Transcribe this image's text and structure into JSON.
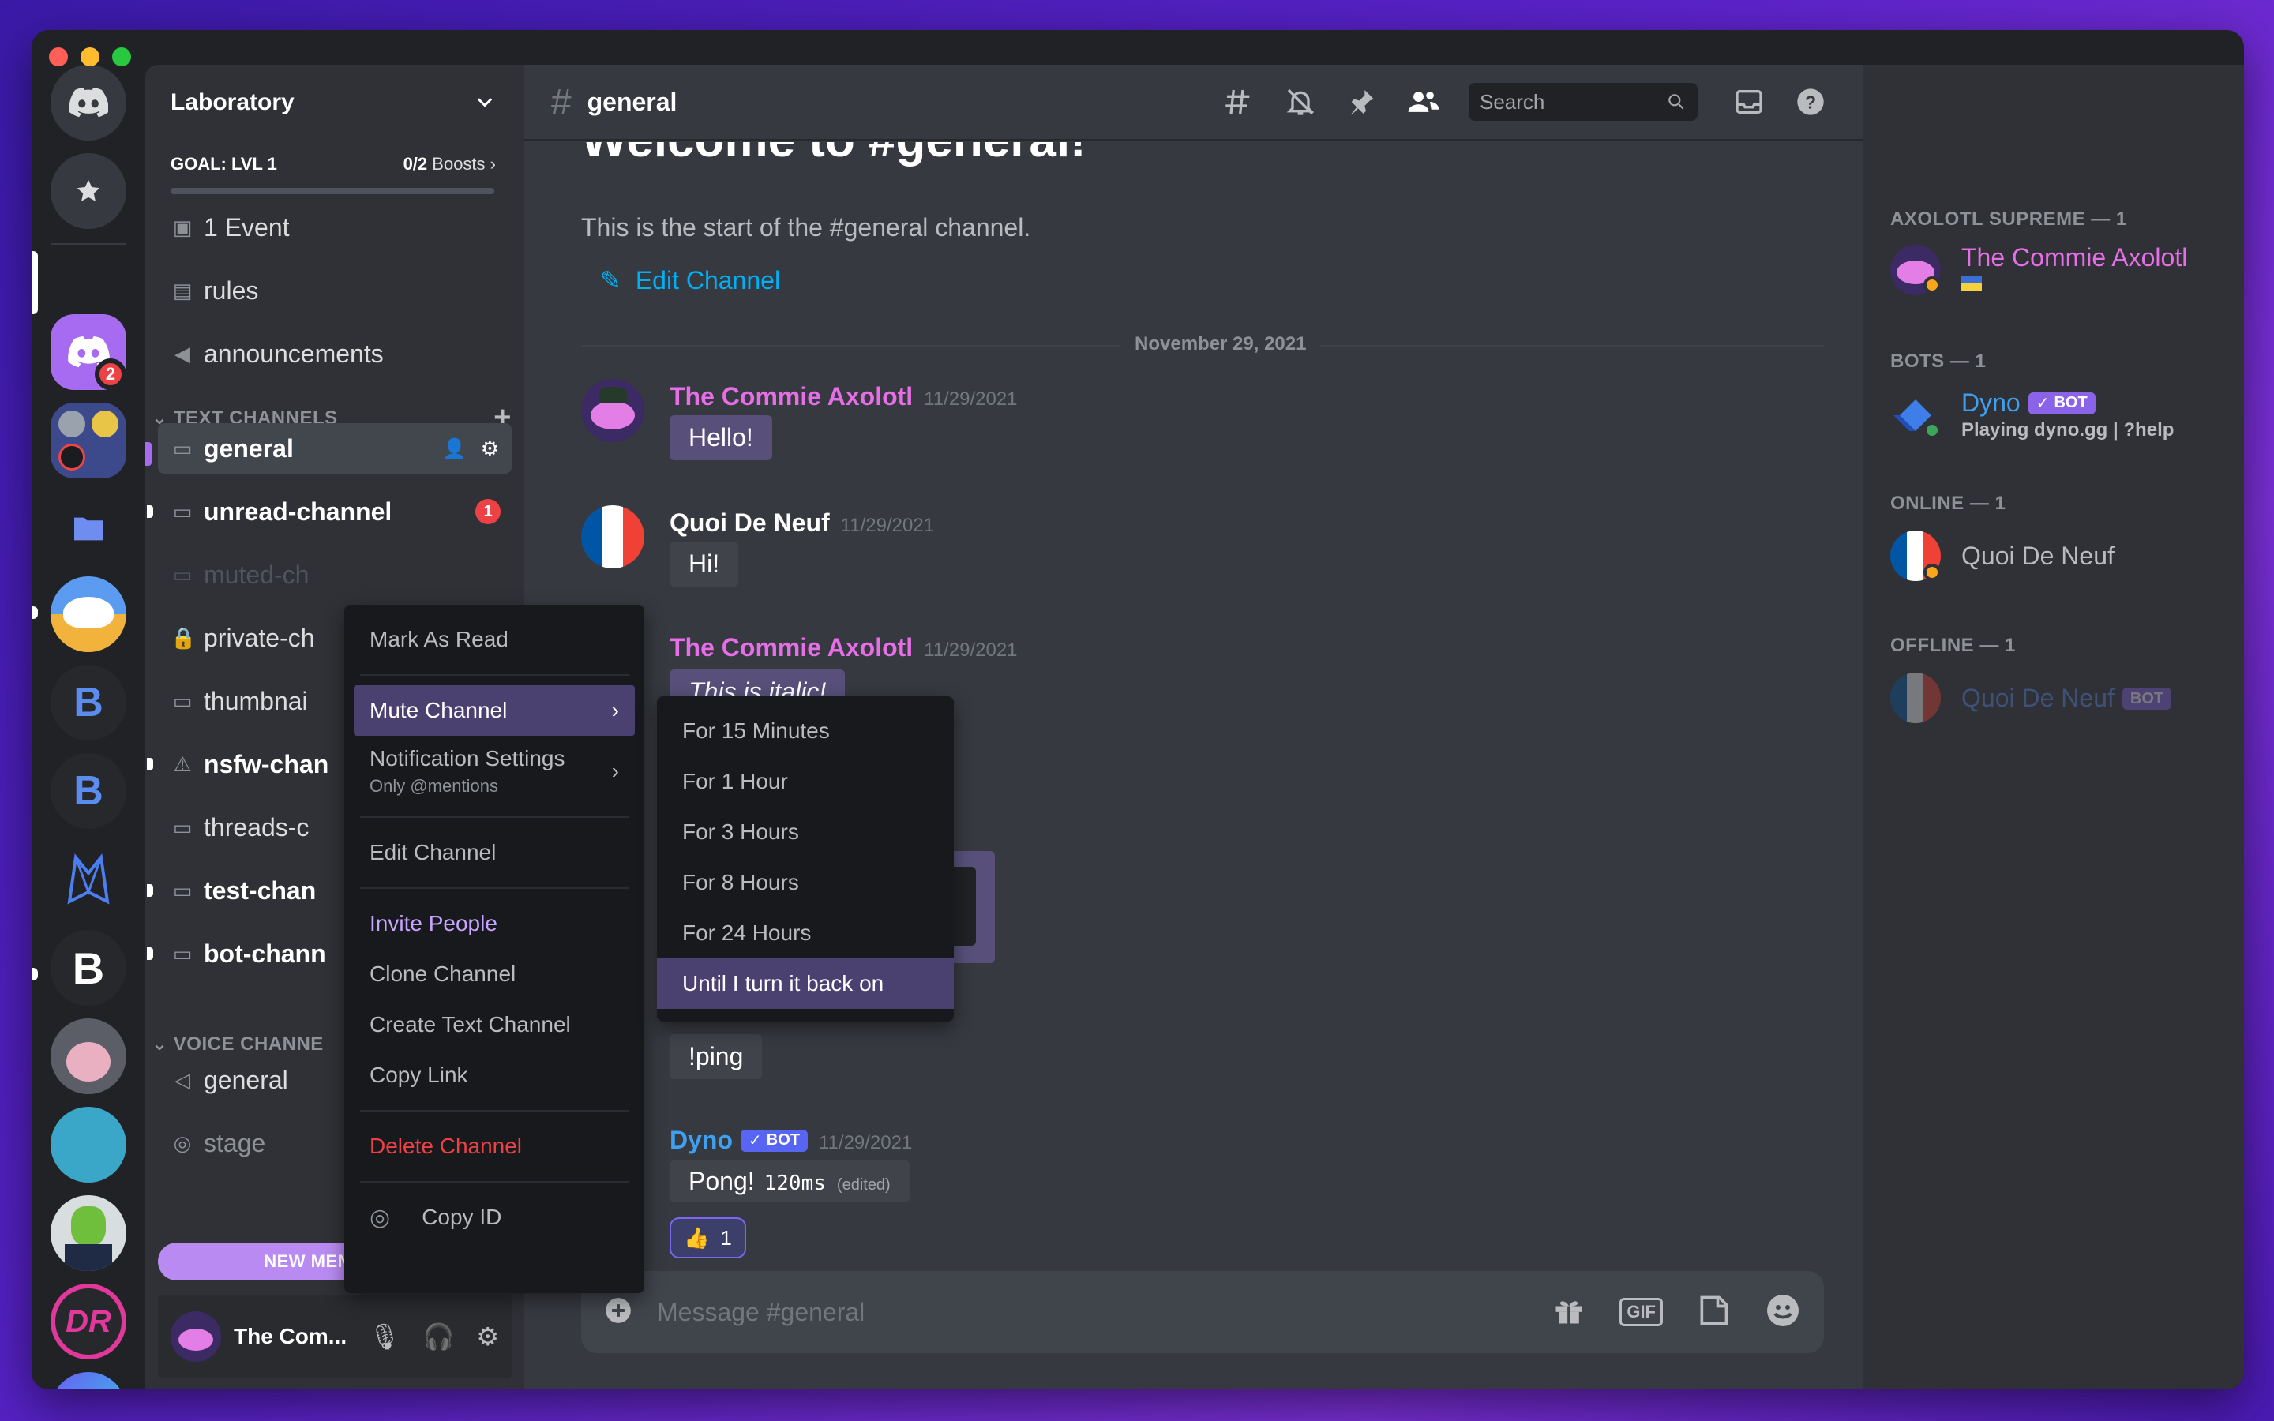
{
  "guild": {
    "name": "Laboratory",
    "goal_label": "GOAL: LVL 1",
    "boost_count": "0/2",
    "boost_word": "Boosts",
    "event_label": "1 Event",
    "channels_top": [
      "rules",
      "announcements"
    ],
    "text_category": "TEXT CHANNELS",
    "voice_category": "VOICE CHANNE",
    "text_channels": [
      "general",
      "unread-channel",
      "muted-ch",
      "private-ch",
      "thumbnai",
      "nsfw-chan",
      "threads-c",
      "test-chan",
      "bot-chann"
    ],
    "voice_channels": [
      "general",
      "stage"
    ],
    "new_mentions": "NEW MENTIONS",
    "unread_badge": "1"
  },
  "servers": {
    "home_badge": "2"
  },
  "user": {
    "name": "The Com..."
  },
  "chat": {
    "channel": "general",
    "welcome": "Welcome to #general!",
    "start_text": "This is the start of the #general channel.",
    "edit_channel": "Edit Channel",
    "date_divider": "November 29, 2021",
    "search_placeholder": "Search",
    "composer_placeholder": "Message #general",
    "gif_label": "GIF",
    "messages": [
      {
        "author": "The Commie Axolotl",
        "time": "11/29/2021",
        "text": "Hello!"
      },
      {
        "author": "Quoi De Neuf",
        "time": "11/29/2021",
        "text": "Hi!"
      },
      {
        "author": "The Commie Axolotl",
        "time": "11/29/2021",
        "text": "This is italic!"
      },
      {
        "author": "",
        "time": "",
        "text": "!ping"
      },
      {
        "author": "Dyno",
        "bot_label": "BOT",
        "time": "11/29/2021",
        "text": "Pong!",
        "code": "120ms",
        "edited": "(edited)",
        "reaction_count": "1"
      }
    ]
  },
  "members": {
    "cat1": "AXOLOTL SUPREME — 1",
    "cat2": "BOTS — 1",
    "cat3": "ONLINE — 1",
    "cat4": "OFFLINE — 1",
    "m1": "The Commie Axolotl",
    "m2": "Dyno",
    "m2_bot": "BOT",
    "m2_status": "Playing dyno.gg | ?help",
    "m3": "Quoi De Neuf",
    "m4": "Quoi De Neuf",
    "m4_bot": "BOT"
  },
  "context_menu": {
    "mark_read": "Mark As Read",
    "mute": "Mute Channel",
    "notif": "Notification Settings",
    "notif_sub": "Only @mentions",
    "edit": "Edit Channel",
    "invite": "Invite People",
    "clone": "Clone Channel",
    "create": "Create Text Channel",
    "copy_link": "Copy Link",
    "delete": "Delete Channel",
    "copy_id": "Copy ID"
  },
  "mute_submenu": [
    "For 15 Minutes",
    "For 1 Hour",
    "For 3 Hours",
    "For 8 Hours",
    "For 24 Hours",
    "Until I turn it back on"
  ],
  "colors": {
    "accent": "#5865f2",
    "axolotl_name": "#e66ee6",
    "dyno_name": "#3fa0f0",
    "menu_hover": "#4a4171",
    "danger": "#ed4245"
  }
}
